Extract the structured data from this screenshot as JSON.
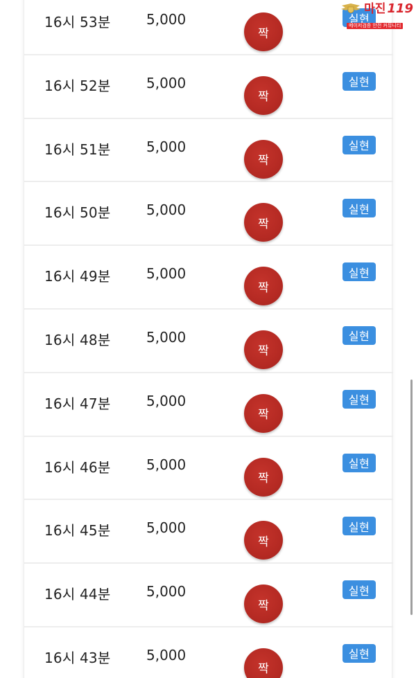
{
  "watermark": {
    "brand": "마진",
    "number": "119",
    "tagline": "메이저검증 안전 커뮤니티"
  },
  "rows": [
    {
      "time": "16시 53분",
      "amount": "5,000",
      "result": "짝",
      "status": "실현"
    },
    {
      "time": "16시 52분",
      "amount": "5,000",
      "result": "짝",
      "status": "실현"
    },
    {
      "time": "16시 51분",
      "amount": "5,000",
      "result": "짝",
      "status": "실현"
    },
    {
      "time": "16시 50분",
      "amount": "5,000",
      "result": "짝",
      "status": "실현"
    },
    {
      "time": "16시 49분",
      "amount": "5,000",
      "result": "짝",
      "status": "실현"
    },
    {
      "time": "16시 48분",
      "amount": "5,000",
      "result": "짝",
      "status": "실현"
    },
    {
      "time": "16시 47분",
      "amount": "5,000",
      "result": "짝",
      "status": "실현"
    },
    {
      "time": "16시 46분",
      "amount": "5,000",
      "result": "짝",
      "status": "실현"
    },
    {
      "time": "16시 45분",
      "amount": "5,000",
      "result": "짝",
      "status": "실현"
    },
    {
      "time": "16시 44분",
      "amount": "5,000",
      "result": "짝",
      "status": "실현"
    },
    {
      "time": "16시 43분",
      "amount": "5,000",
      "result": "짝",
      "status": "실현"
    }
  ],
  "colors": {
    "result_ball": "#b52a23",
    "status_badge": "#3b8fe0",
    "watermark": "#d9252d"
  },
  "icons": {
    "watermark_emblem": "winged-shield-icon"
  }
}
